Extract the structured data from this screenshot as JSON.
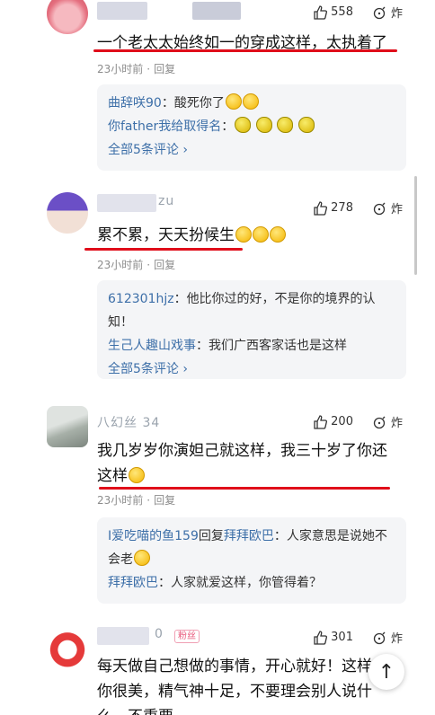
{
  "comments": [
    {
      "likes": "558",
      "dislike_label": "炸",
      "text": "一个老太太始终如一的穿成这样，太执着了",
      "time": "23小时前",
      "reply_label": "回复",
      "avatar_icon": "avatar-icon",
      "replies": [
        {
          "name": "曲辞咲90",
          "sep": "：",
          "text": "酸死你了"
        },
        {
          "name": "你father我给取得名",
          "sep": "：",
          "text": ""
        }
      ],
      "more": "全部5条评论 ›"
    },
    {
      "username": "zu",
      "likes": "278",
      "dislike_label": "炸",
      "text": "累不累，天天扮候生",
      "time": "23小时前",
      "reply_label": "回复",
      "replies": [
        {
          "name": "612301hjz",
          "sep": "：",
          "text": "他比你过的好，不是你的境界的认知！"
        },
        {
          "name": "生己人趣山戏事",
          "sep": "：",
          "text": "我们广西客家话也是这样"
        }
      ],
      "more": "全部5条评论 ›"
    },
    {
      "username": "八幻丝 34",
      "likes": "200",
      "dislike_label": "炸",
      "text_line1": "我几岁岁你演妲己就这样，我三十岁了你还",
      "text_line2": "这样",
      "time": "23小时前",
      "reply_label": "回复",
      "replies": [
        {
          "name": "I爱吃喵的鱼159",
          "mid": "回复",
          "name2": "拜拜欧巴",
          "sep": "：",
          "text": "人家意思是说她不会老"
        },
        {
          "name": "拜拜欧巴",
          "sep": "：",
          "text": "人家就爱这样，你管得着？"
        }
      ]
    },
    {
      "username": "0",
      "tag": "粉丝",
      "likes": "301",
      "dislike_label": "炸",
      "text_line1": "每天做自己想做的事情，开心就好！这样",
      "text_line2": "你很美，精气神十足，不要理会别人说什",
      "text_line3": "么，不重要"
    }
  ],
  "colors": {
    "underline": "#e00d1a",
    "link": "#3d6fa8",
    "meta": "#8c8c8c",
    "reply_bg": "#f4f5f7"
  },
  "icons": {
    "like": "thumbs-up-icon",
    "dislike": "bomb-icon",
    "back_to_top": "arrow-up-icon"
  },
  "back_to_top_glyph": "↑"
}
